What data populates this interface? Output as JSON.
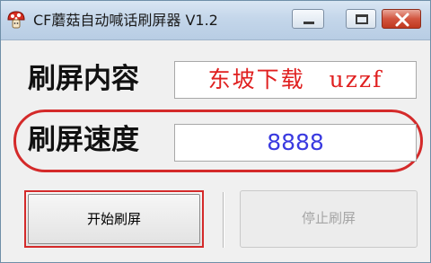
{
  "window": {
    "title": "CF蘑菇自动喊话刷屏器 V1.2",
    "icon": "mushroom-icon",
    "controls": [
      "minimize-icon",
      "maximize-icon",
      "close-icon"
    ]
  },
  "form": {
    "content_label": "刷屏内容",
    "content_value": "东坡下载　uzzf",
    "speed_label": "刷屏速度",
    "speed_value": "8888"
  },
  "buttons": {
    "start_label": "开始刷屏",
    "stop_label": "停止刷屏",
    "stop_enabled": false
  },
  "colors": {
    "content_text": "#e02020",
    "speed_text": "#3a3ae0",
    "highlight": "#d42a2a",
    "disabled_text": "#a5a5a5"
  }
}
